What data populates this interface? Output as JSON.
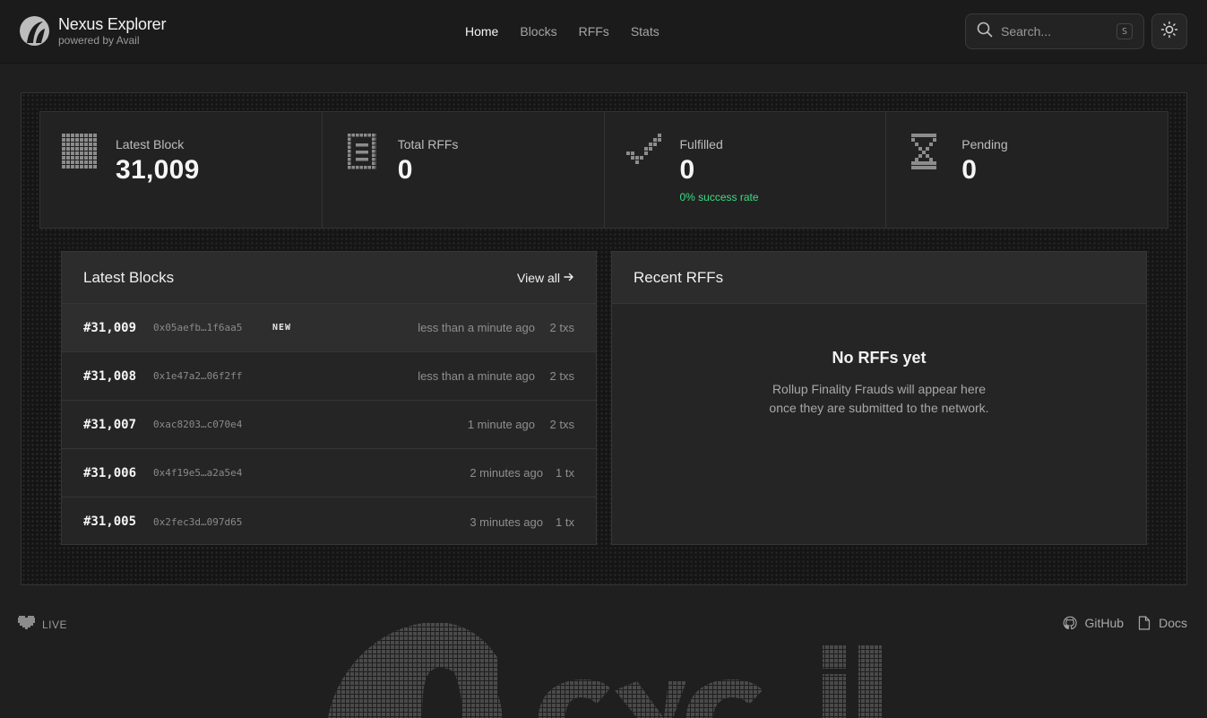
{
  "header": {
    "brand_title": "Nexus Explorer",
    "brand_subtitle": "powered by Avail",
    "nav": [
      "Home",
      "Blocks",
      "RFFs",
      "Stats"
    ],
    "active_nav": "Home",
    "search_placeholder": "Search...",
    "search_shortcut": "S"
  },
  "stats": [
    {
      "label": "Latest Block",
      "value": "31,009",
      "icon": "grid-block-icon"
    },
    {
      "label": "Total RFFs",
      "value": "0",
      "icon": "document-icon"
    },
    {
      "label": "Fulfilled",
      "value": "0",
      "note": "0% success rate",
      "icon": "checkmark-icon"
    },
    {
      "label": "Pending",
      "value": "0",
      "icon": "hourglass-icon"
    }
  ],
  "latest_blocks": {
    "title": "Latest Blocks",
    "view_all": "View all",
    "rows": [
      {
        "number": "#31,009",
        "hash": "0x05aefb…1f6aa5",
        "badge": "NEW",
        "time": "less than a minute ago",
        "txs": "2 txs"
      },
      {
        "number": "#31,008",
        "hash": "0x1e47a2…06f2ff",
        "badge": "",
        "time": "less than a minute ago",
        "txs": "2 txs"
      },
      {
        "number": "#31,007",
        "hash": "0xac8203…c070e4",
        "badge": "",
        "time": "1 minute ago",
        "txs": "2 txs"
      },
      {
        "number": "#31,006",
        "hash": "0x4f19e5…a2a5e4",
        "badge": "",
        "time": "2 minutes ago",
        "txs": "1 tx"
      },
      {
        "number": "#31,005",
        "hash": "0x2fec3d…097d65",
        "badge": "",
        "time": "3 minutes ago",
        "txs": "1 tx"
      }
    ]
  },
  "recent_rffs": {
    "title": "Recent RFFs",
    "empty_title": "No RFFs yet",
    "empty_line1": "Rollup Finality Frauds will appear here",
    "empty_line2": "once they are submitted to the network."
  },
  "footer": {
    "live_label": "LIVE",
    "links": [
      "GitHub",
      "Docs"
    ]
  },
  "colors": {
    "background": "#1f1f1f",
    "accent_success": "#3ddc84"
  }
}
